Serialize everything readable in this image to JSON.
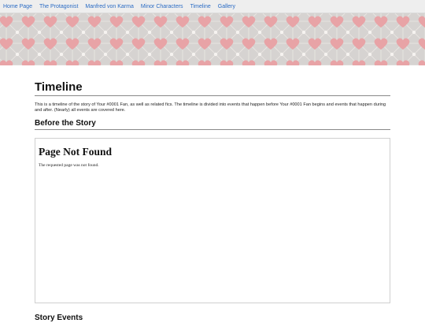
{
  "nav": {
    "items": [
      "Home Page",
      "The Protagonist",
      "Manfred von Karma",
      "Minor Characters",
      "Timeline",
      "Gallery"
    ]
  },
  "colors": {
    "link": "#2a6bc4",
    "banner_bg": "#d6d3d1",
    "heart": "#e8a3a6",
    "sparkle": "#f4f1ee"
  },
  "banner": {
    "pattern_icon": "heart-icon"
  },
  "main": {
    "title": "Timeline",
    "intro": "This is a timeline of the story of Your #0001 Fan, as well as related fics. The timeline is divided into events that happen before Your #0001 Fan begins and events that happen during and after. (Nearly) all events are covered here.",
    "sections": [
      {
        "heading": "Before the Story"
      },
      {
        "heading": "Story Events"
      }
    ],
    "embed": {
      "title": "Page Not Found",
      "message": "The requested page was not found."
    }
  }
}
